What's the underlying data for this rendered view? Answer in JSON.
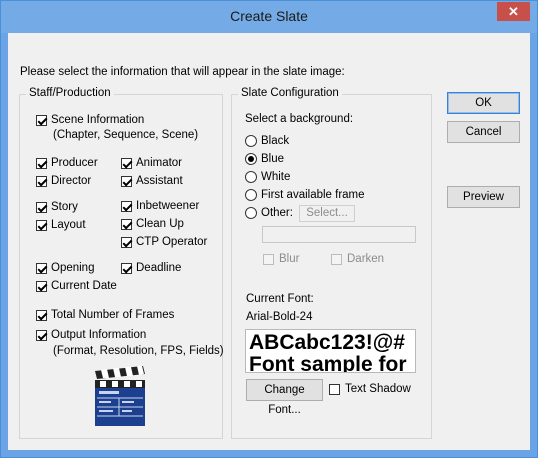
{
  "window": {
    "title": "Create Slate",
    "close_glyph": "✕"
  },
  "instruction": "Please select the information that will appear in the slate image:",
  "staff": {
    "title": "Staff/Production",
    "scene_info": "Scene Information",
    "scene_info_sub": "(Chapter, Sequence, Scene)",
    "producer": "Producer",
    "director": "Director",
    "animator": "Animator",
    "assistant": "Assistant",
    "story": "Story",
    "layout": "Layout",
    "inbetweener": "Inbetweener",
    "clean_up": "Clean Up",
    "ctp_operator": "CTP Operator",
    "opening": "Opening",
    "deadline": "Deadline",
    "current_date": "Current Date",
    "total_frames": "Total Number of Frames",
    "output_info": "Output Information",
    "output_info_sub": "(Format, Resolution, FPS, Fields)",
    "clapper_icon": "clapperboard-icon"
  },
  "config": {
    "title": "Slate Configuration",
    "bg_prompt": "Select a background:",
    "bg_options": [
      "Black",
      "Blue",
      "White",
      "First available frame",
      "Other:"
    ],
    "bg_selected": "Blue",
    "select_label": "Select...",
    "blur_label": "Blur",
    "darken_label": "Darken",
    "current_font_label": "Current Font:",
    "current_font": "Arial-Bold-24",
    "font_sample_line1": "ABCabc123!@#",
    "font_sample_line2": "Font sample for",
    "change_font_label": "Change Font...",
    "text_shadow_label": "Text Shadow"
  },
  "buttons": {
    "ok": "OK",
    "cancel": "Cancel",
    "preview": "Preview"
  },
  "colors": {
    "title_bar": "#74aae6",
    "close_button": "#c7504a",
    "default_button_border": "#3c7fd6"
  }
}
